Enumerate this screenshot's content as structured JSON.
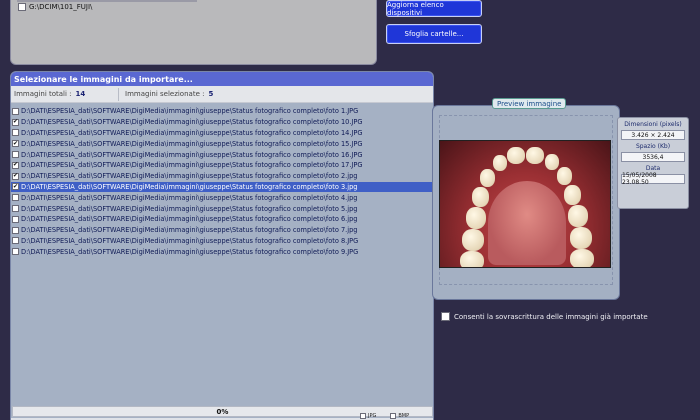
{
  "device_list": {
    "items": [
      {
        "label": "G:\\DCIM\\101_FUJI\\",
        "checked": false
      }
    ]
  },
  "buttons": {
    "refresh_devices": "Aggiorna elenco dispositivi",
    "browse_folders": "Sfoglia cartelle..."
  },
  "import_panel": {
    "title": "Selezionare le immagini da importare...",
    "total_label": "Immagini totali :",
    "total_value": "14",
    "selected_label": "Immagini selezionate :",
    "selected_value": "5"
  },
  "files": [
    {
      "path": "D:\\DATI\\ESPESIA_dati\\SOFTWARE\\DigiMedia\\immagini\\giuseppe\\Status fotografico completo\\foto 1.JPG",
      "checked": false,
      "selected": false
    },
    {
      "path": "D:\\DATI\\ESPESIA_dati\\SOFTWARE\\DigiMedia\\immagini\\giuseppe\\Status fotografico completo\\foto 10.JPG",
      "checked": true,
      "selected": false
    },
    {
      "path": "D:\\DATI\\ESPESIA_dati\\SOFTWARE\\DigiMedia\\immagini\\giuseppe\\Status fotografico completo\\foto 14.JPG",
      "checked": false,
      "selected": false
    },
    {
      "path": "D:\\DATI\\ESPESIA_dati\\SOFTWARE\\DigiMedia\\immagini\\giuseppe\\Status fotografico completo\\foto 15.JPG",
      "checked": true,
      "selected": false
    },
    {
      "path": "D:\\DATI\\ESPESIA_dati\\SOFTWARE\\DigiMedia\\immagini\\giuseppe\\Status fotografico completo\\foto 16.JPG",
      "checked": false,
      "selected": false
    },
    {
      "path": "D:\\DATI\\ESPESIA_dati\\SOFTWARE\\DigiMedia\\immagini\\giuseppe\\Status fotografico completo\\foto 17.JPG",
      "checked": true,
      "selected": false
    },
    {
      "path": "D:\\DATI\\ESPESIA_dati\\SOFTWARE\\DigiMedia\\immagini\\giuseppe\\Status fotografico completo\\foto 2.jpg",
      "checked": true,
      "selected": false
    },
    {
      "path": "D:\\DATI\\ESPESIA_dati\\SOFTWARE\\DigiMedia\\immagini\\giuseppe\\Status fotografico completo\\foto 3.jpg",
      "checked": true,
      "selected": true
    },
    {
      "path": "D:\\DATI\\ESPESIA_dati\\SOFTWARE\\DigiMedia\\immagini\\giuseppe\\Status fotografico completo\\foto 4.jpg",
      "checked": false,
      "selected": false
    },
    {
      "path": "D:\\DATI\\ESPESIA_dati\\SOFTWARE\\DigiMedia\\immagini\\giuseppe\\Status fotografico completo\\foto 5.jpg",
      "checked": false,
      "selected": false
    },
    {
      "path": "D:\\DATI\\ESPESIA_dati\\SOFTWARE\\DigiMedia\\immagini\\giuseppe\\Status fotografico completo\\foto 6.jpg",
      "checked": false,
      "selected": false
    },
    {
      "path": "D:\\DATI\\ESPESIA_dati\\SOFTWARE\\DigiMedia\\immagini\\giuseppe\\Status fotografico completo\\foto 7.jpg",
      "checked": false,
      "selected": false
    },
    {
      "path": "D:\\DATI\\ESPESIA_dati\\SOFTWARE\\DigiMedia\\immagini\\giuseppe\\Status fotografico completo\\foto 8.JPG",
      "checked": false,
      "selected": false
    },
    {
      "path": "D:\\DATI\\ESPESIA_dati\\SOFTWARE\\DigiMedia\\immagini\\giuseppe\\Status fotografico completo\\foto 9.JPG",
      "checked": false,
      "selected": false
    }
  ],
  "progress": {
    "label": "0%",
    "fraction": 0
  },
  "preview": {
    "title": "Preview immagine",
    "dimensions_label": "Dimensioni (pixels)",
    "dimensions_value": "3.426 × 2.424",
    "size_label": "Spazio (Kb)",
    "size_value": "3536,4",
    "date_label": "Data",
    "date_value": "15/05/2008 23.08.50"
  },
  "overwrite_option": {
    "label": "Consenti la sovrascrittura delle immagini già importate",
    "checked": false
  },
  "format_options": [
    {
      "label": "JPG",
      "checked": false
    },
    {
      "label": "BMP",
      "checked": false
    }
  ],
  "colors": {
    "background": "#2e2b47",
    "button_blue": "#1f36d8",
    "title_bar": "#5a68d2",
    "selection": "#3f5fc6"
  }
}
